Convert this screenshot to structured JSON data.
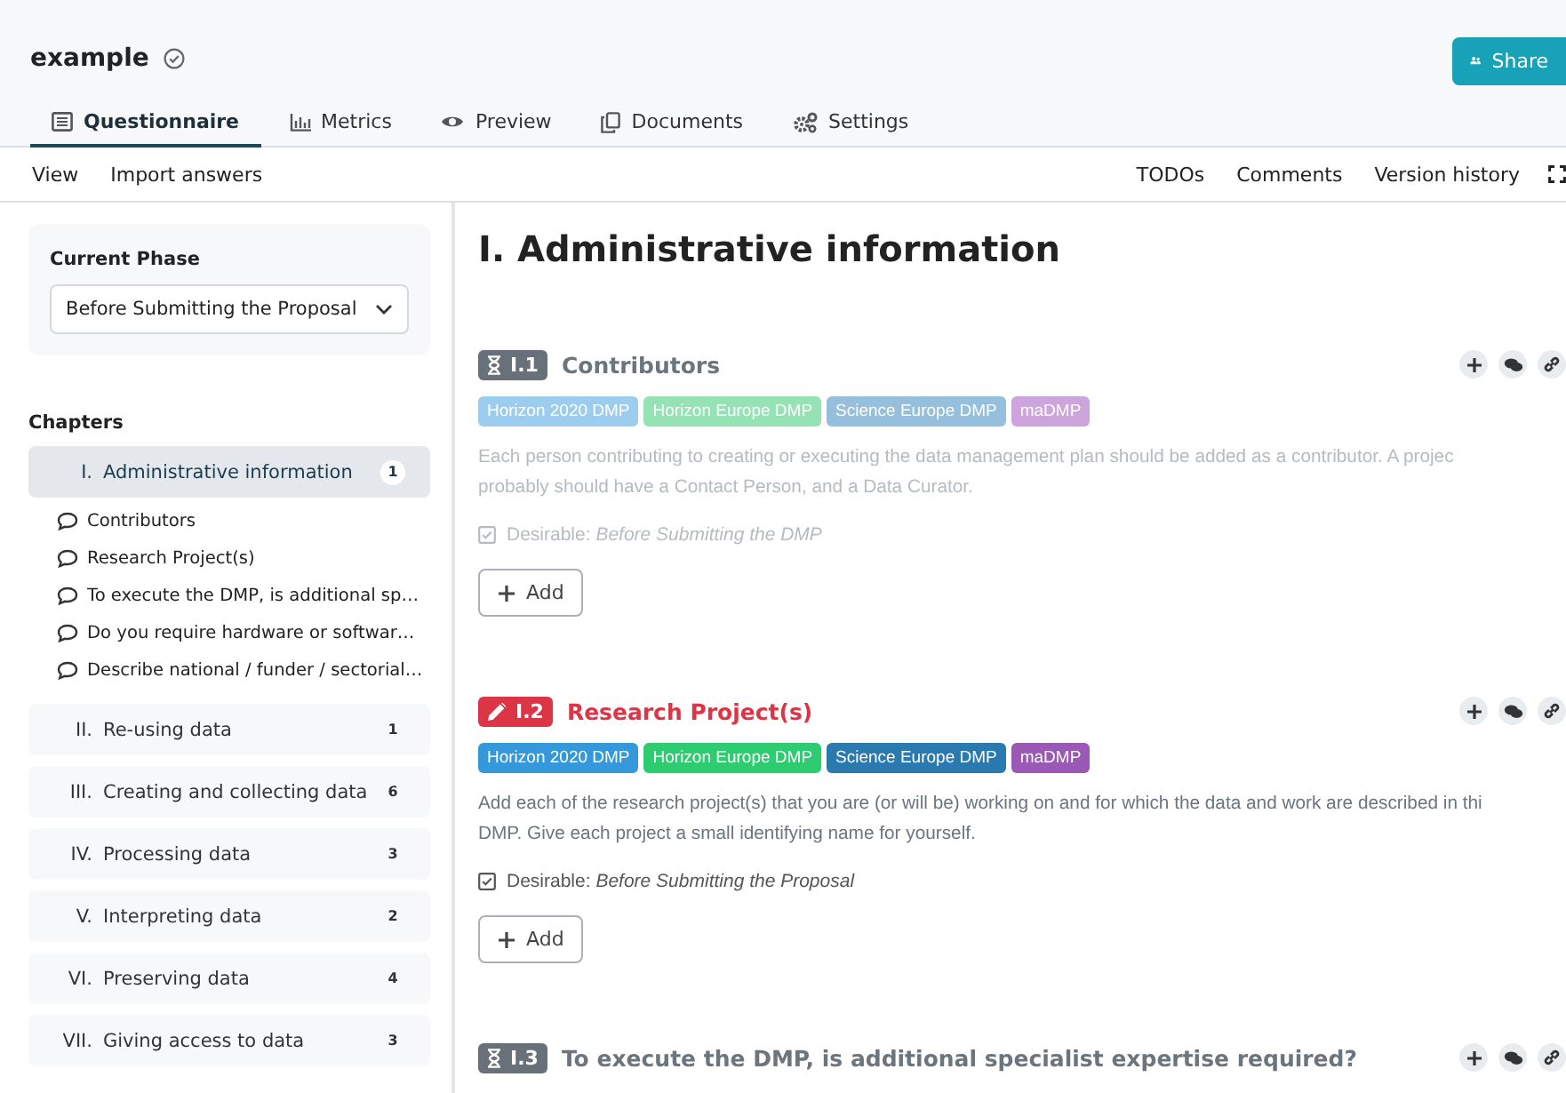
{
  "project": {
    "title": "example",
    "share_label": "Share"
  },
  "tabs": [
    {
      "label": "Questionnaire",
      "selected": true
    },
    {
      "label": "Metrics",
      "selected": false
    },
    {
      "label": "Preview",
      "selected": false
    },
    {
      "label": "Documents",
      "selected": false
    },
    {
      "label": "Settings",
      "selected": false
    }
  ],
  "toolbar": {
    "left": [
      "View",
      "Import answers"
    ],
    "right": [
      "TODOs",
      "Comments",
      "Version history"
    ]
  },
  "sidebar": {
    "phase_label": "Current Phase",
    "phase_value": "Before Submitting the Proposal",
    "chapters_label": "Chapters",
    "chapters": [
      {
        "number": "I.",
        "title": "Administrative information",
        "count": "1",
        "selected": true,
        "children": [
          {
            "title": "Contributors"
          },
          {
            "title": "Research Project(s)"
          },
          {
            "title": "To execute the DMP, is additional sp…"
          },
          {
            "title": "Do you require hardware or softwar…"
          },
          {
            "title": "Describe national / funder / sectorial…"
          }
        ]
      },
      {
        "number": "II.",
        "title": "Re-using data",
        "count": "1",
        "selected": false
      },
      {
        "number": "III.",
        "title": "Creating and collecting data",
        "count": "6",
        "selected": false
      },
      {
        "number": "IV.",
        "title": "Processing data",
        "count": "3",
        "selected": false
      },
      {
        "number": "V.",
        "title": "Interpreting data",
        "count": "2",
        "selected": false
      },
      {
        "number": "VI.",
        "title": "Preserving data",
        "count": "4",
        "selected": false
      },
      {
        "number": "VII.",
        "title": "Giving access to data",
        "count": "3",
        "selected": false
      }
    ]
  },
  "chapter_title": "I. Administrative information",
  "questions": [
    {
      "kind": "pending",
      "number": "I.1",
      "title": "Contributors",
      "faded": true,
      "tags": [
        {
          "label": "Horizon 2020 DMP",
          "color": "#9ccdef"
        },
        {
          "label": "Horizon Europe DMP",
          "color": "#95e2b4"
        },
        {
          "label": "Science Europe DMP",
          "color": "#95bfdc"
        },
        {
          "label": "maDMP",
          "color": "#cda5dc"
        }
      ],
      "description": [
        "Each person contributing to creating or executing the data management plan should be added as a contributor. A projec",
        "probably should have a Contact Person, and a Data Curator."
      ],
      "desirable_label": "Desirable:",
      "desirable_phase": "Before Submitting the DMP",
      "add_label": "Add"
    },
    {
      "kind": "required",
      "number": "I.2",
      "title": "Research Project(s)",
      "faded": false,
      "tags": [
        {
          "label": "Horizon 2020 DMP",
          "color": "#3498db"
        },
        {
          "label": "Horizon Europe DMP",
          "color": "#2ecc71"
        },
        {
          "label": "Science Europe DMP",
          "color": "#2a7ab0"
        },
        {
          "label": "maDMP",
          "color": "#9b59b6"
        }
      ],
      "description": [
        "Add each of the research project(s) that you are (or will be) working on and for which the data and work are described in thi",
        "DMP. Give each project a small identifying name for yourself."
      ],
      "desirable_label": "Desirable:",
      "desirable_phase": "Before Submitting the Proposal",
      "add_label": "Add"
    },
    {
      "kind": "pending",
      "number": "I.3",
      "title": "To execute the DMP, is additional specialist expertise required?"
    }
  ]
}
